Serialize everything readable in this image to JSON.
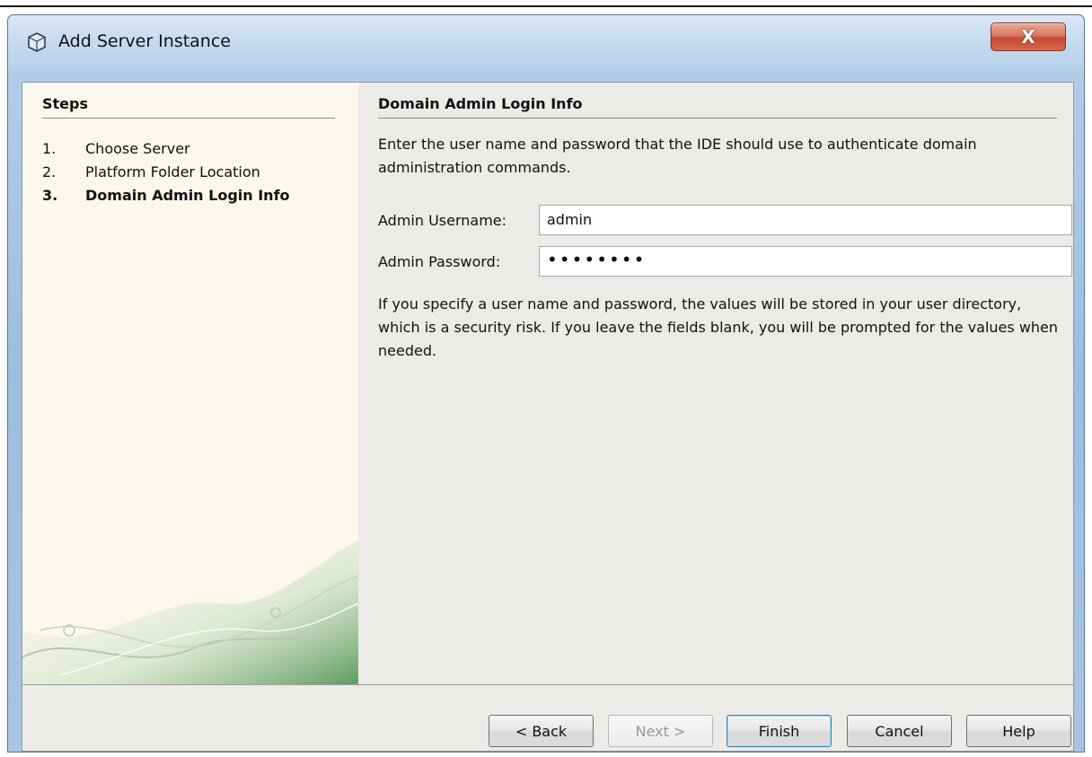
{
  "window": {
    "title": "Add Server Instance",
    "close_label": "X"
  },
  "steps": {
    "title": "Steps",
    "items": [
      {
        "num": "1.",
        "label": "Choose Server"
      },
      {
        "num": "2.",
        "label": "Platform Folder Location"
      },
      {
        "num": "3.",
        "label": "Domain Admin Login Info"
      }
    ]
  },
  "content": {
    "title": "Domain Admin Login Info",
    "intro": "Enter the user name and password that the IDE should use to authenticate domain administration commands.",
    "username_label": "Admin Username:",
    "username_value": "admin",
    "password_label": "Admin Password:",
    "password_value": "••••••••",
    "note": "If you specify a user name and password, the values will be stored in your user directory, which is a security risk. If you leave the fields blank, you will be prompted for the values when needed."
  },
  "buttons": {
    "back": "< Back",
    "next": "Next >",
    "finish": "Finish",
    "cancel": "Cancel",
    "help": "Help"
  }
}
